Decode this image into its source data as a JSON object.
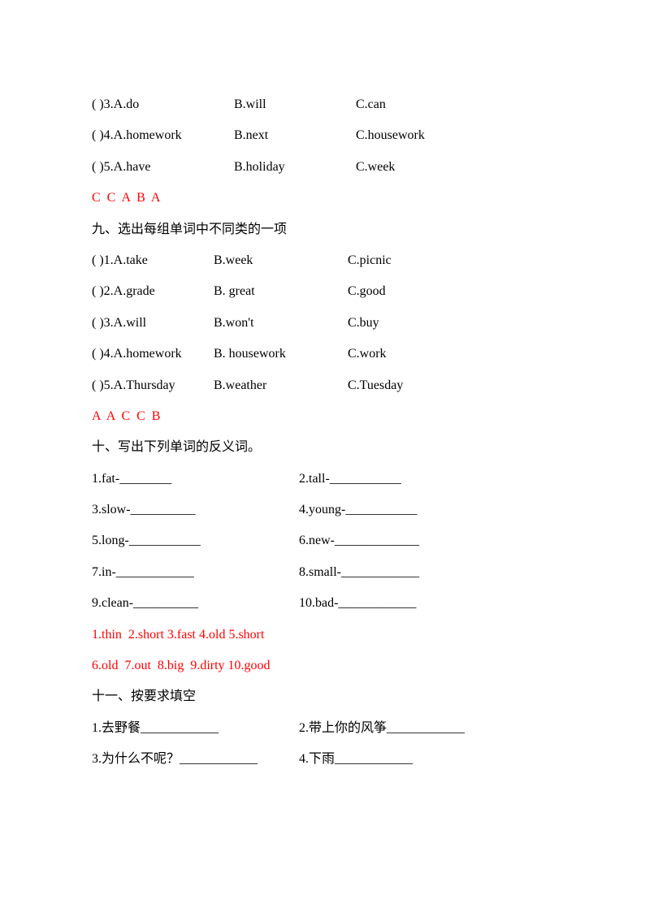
{
  "section8_tail": {
    "rows": [
      {
        "n": "3",
        "a": "do",
        "b": "will",
        "c": "can"
      },
      {
        "n": "4",
        "a": "homework",
        "b": "next",
        "c": "housework"
      },
      {
        "n": "5",
        "a": "have",
        "b": "holiday",
        "c": "week"
      }
    ],
    "answers": "C  C  A  B  A"
  },
  "section9": {
    "title": "九、选出每组单词中不同类的一项",
    "rows": [
      {
        "n": "1",
        "a": "take",
        "b": "week",
        "c": "picnic"
      },
      {
        "n": "2",
        "a": "grade",
        "b": " great",
        "c": "good"
      },
      {
        "n": "3",
        "a": "will",
        "b": "won't",
        "c": "buy"
      },
      {
        "n": "4",
        "a": "homework",
        "b": " housework",
        "c": "work"
      },
      {
        "n": "5",
        "a": "Thursday",
        "b": "weather",
        "c": "Tuesday"
      }
    ],
    "answers": "A  A  C  C  B"
  },
  "section10": {
    "title": "十、写出下列单词的反义词。",
    "pairs": [
      {
        "l": "1.fat-________",
        "r": "2.tall-___________"
      },
      {
        "l": "3.slow-__________",
        "r": "4.young-___________"
      },
      {
        "l": "5.long-___________",
        "r": "6.new-_____________"
      },
      {
        "l": "7.in-____________",
        "r": "8.small-____________"
      },
      {
        "l": "9.clean-__________",
        "r": "10.bad-____________"
      }
    ],
    "ans1": "1.thin  2.short 3.fast 4.old 5.short",
    "ans2": "6.old  7.out  8.big  9.dirty 10.good"
  },
  "section11": {
    "title": "十一、按要求填空",
    "pairs": [
      {
        "l": "1.去野餐____________",
        "r": "2.带上你的风筝____________"
      },
      {
        "l": "3.为什么不呢？____________",
        "r": "4.下雨____________"
      }
    ]
  }
}
